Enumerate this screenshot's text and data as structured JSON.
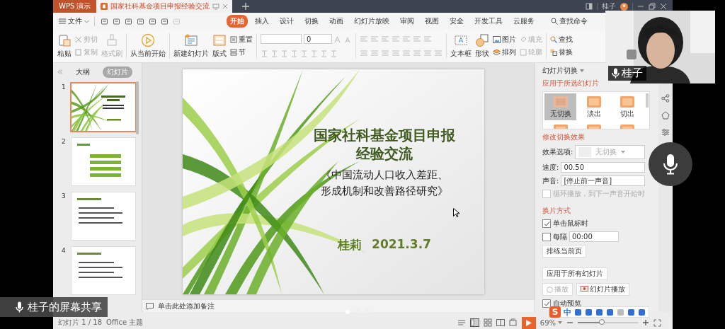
{
  "title_bar": {
    "app_tab": "WPS 演示",
    "document_tab": "国家社科基金项目申报经验交流",
    "user": "桂子"
  },
  "menu_bar": {
    "file_menu": "文件",
    "tabs": [
      {
        "label": "开始",
        "selected": true
      },
      {
        "label": "插入",
        "selected": false
      },
      {
        "label": "设计",
        "selected": false
      },
      {
        "label": "切换",
        "selected": false
      },
      {
        "label": "动画",
        "selected": false
      },
      {
        "label": "幻灯片放映",
        "selected": false
      },
      {
        "label": "审阅",
        "selected": false
      },
      {
        "label": "视图",
        "selected": false
      },
      {
        "label": "安全",
        "selected": false
      },
      {
        "label": "开发工具",
        "selected": false
      },
      {
        "label": "云服务",
        "selected": false
      }
    ],
    "search_command": "查找命令"
  },
  "toolbar": {
    "paste": "粘贴",
    "clipboard": [
      {
        "label": "剪切",
        "disabled": true
      },
      {
        "label": "复制",
        "disabled": true
      }
    ],
    "format_painter": {
      "label": "格式刷",
      "disabled": true
    },
    "play_from_current": "从当前开始",
    "new_slide": "新建幻灯片",
    "layout": "版式",
    "reset": "重置",
    "section": "节",
    "font_size": "0",
    "text_box": "文本框",
    "shape": "形状",
    "picture": "图片",
    "arrange": "排列",
    "fill": {
      "label": "填充",
      "disabled": true
    },
    "outline": {
      "label": "轮廓",
      "disabled": true
    },
    "find": "查找",
    "replace": "替换"
  },
  "outline_panel": {
    "tabs": [
      {
        "label": "大纲",
        "selected": false
      },
      {
        "label": "幻灯片",
        "selected": true
      }
    ],
    "thumbnails": [
      {
        "number": "1",
        "kind": "title",
        "selected": true
      },
      {
        "number": "2",
        "kind": "agenda",
        "selected": false
      },
      {
        "number": "3",
        "kind": "bullets",
        "selected": false
      },
      {
        "number": "4",
        "kind": "bullets",
        "selected": false
      }
    ]
  },
  "slide": {
    "title": "国家社科基金项目申报经验交流",
    "subtitle": "《中国流动人口收入差距、形成机制和改善路径研究》",
    "author": "桂莉",
    "date": "2021.3.7"
  },
  "notes_placeholder": "单击此处添加备注",
  "transition_panel": {
    "header": "幻灯片切换",
    "apply_selected_heading": "应用于所选幻灯片",
    "effects": [
      {
        "label": "无切换",
        "selected": true
      },
      {
        "label": "淡出",
        "selected": false
      },
      {
        "label": "切出",
        "selected": false
      },
      {
        "selected": false
      },
      {
        "selected": false
      },
      {
        "selected": false
      }
    ],
    "modify_heading": "修改切换效果",
    "effect_options_label": "效果选项:",
    "effect_options_value": "无切换",
    "speed_label": "速度:",
    "speed": "00.50",
    "sound_label": "声音:",
    "sound": "[停止前一声音]",
    "loop": {
      "label": "循环播放，到下一声音开始时",
      "checked": false,
      "disabled": true
    },
    "advance_heading": "换片方式",
    "on_click": {
      "label": "单击鼠标时",
      "checked": true
    },
    "every": {
      "label": "每隔",
      "checked": false,
      "value": "00:00"
    },
    "rehearse": "排练当前页",
    "apply_all": "应用于所有幻灯片",
    "play": {
      "label": "播放",
      "disabled": true
    },
    "slideshow": "幻灯片播放",
    "auto_preview": {
      "label": "自动预览",
      "checked": true
    }
  },
  "status_bar": {
    "slide_count": "幻灯片 1 / 18",
    "theme": "Office 主题",
    "zoom": "69%",
    "zoom_slider": {
      "level": 0.4
    }
  },
  "ime_toolbar": {
    "logo": "S",
    "mode": "中"
  },
  "video": {
    "participant": "桂子",
    "screen_share_label": "桂子的屏幕共享"
  }
}
